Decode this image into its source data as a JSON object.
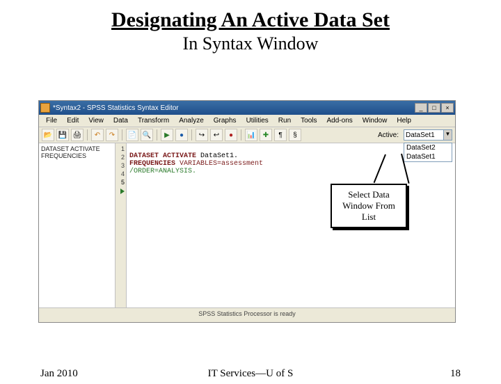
{
  "slide": {
    "title": "Designating An Active Data Set",
    "subtitle": "In Syntax  Window"
  },
  "window": {
    "title": "*Syntax2 - SPSS Statistics Syntax Editor",
    "min": "_",
    "max": "□",
    "close": "×"
  },
  "menus": {
    "file": "File",
    "edit": "Edit",
    "view": "View",
    "data": "Data",
    "transform": "Transform",
    "analyze": "Analyze",
    "graphs": "Graphs",
    "utilities": "Utilities",
    "run": "Run",
    "tools": "Tools",
    "addons": "Add-ons",
    "window": "Window",
    "help": "Help"
  },
  "toolbar": {
    "active_label": "Active:",
    "active_value": "DataSet1",
    "dropdown": [
      "DataSet2",
      "DataSet1"
    ]
  },
  "nav": {
    "line1": "DATASET ACTIVATE",
    "line2": "FREQUENCIES"
  },
  "gutter": {
    "l1": "1",
    "l2": "2",
    "l3": "3",
    "l4": "4",
    "l5": "5"
  },
  "code": {
    "l2a": "DATASET ACTIVATE",
    "l2b": " DataSet1.",
    "l3a": "FREQUENCIES",
    "l3b": " VARIABLES=assessment",
    "l4": "  /ORDER=ANALYSIS."
  },
  "status": "SPSS Statistics Processor is ready",
  "callout": {
    "l1": "Select Data",
    "l2": "Window From",
    "l3": "List"
  },
  "footer": {
    "left": "Jan 2010",
    "center": "IT Services—U of  S",
    "right": "18"
  }
}
